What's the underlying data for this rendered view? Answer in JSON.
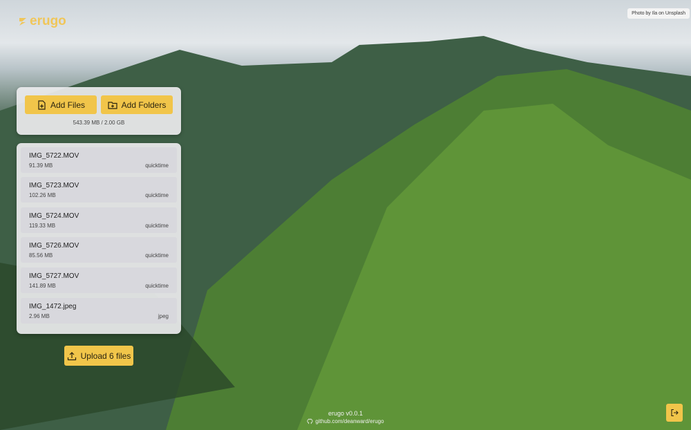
{
  "app": {
    "logo_text": "erugo",
    "version": "erugo v0.0.1",
    "repo": "github.com/deanward/erugo"
  },
  "credit": "Photo by Ila on Unsplash",
  "toolbar": {
    "add_files": "Add Files",
    "add_folders": "Add Folders",
    "quota": "543.39 MB / 2.00 GB"
  },
  "files": [
    {
      "name": "IMG_5722.MOV",
      "size": "91.39 MB",
      "type": "quicktime"
    },
    {
      "name": "IMG_5723.MOV",
      "size": "102.26 MB",
      "type": "quicktime"
    },
    {
      "name": "IMG_5724.MOV",
      "size": "119.33 MB",
      "type": "quicktime"
    },
    {
      "name": "IMG_5726.MOV",
      "size": "85.56 MB",
      "type": "quicktime"
    },
    {
      "name": "IMG_5727.MOV",
      "size": "141.89 MB",
      "type": "quicktime"
    },
    {
      "name": "IMG_1472.jpeg",
      "size": "2.96 MB",
      "type": "jpeg"
    }
  ],
  "upload_label": "Upload 6 files",
  "colors": {
    "accent": "#f1c54a",
    "panel": "#ebebee"
  },
  "icons": {
    "add_files": "file-plus-icon",
    "add_folders": "folder-plus-icon",
    "upload": "upload-icon",
    "repo": "github-icon",
    "logout": "logout-icon"
  }
}
